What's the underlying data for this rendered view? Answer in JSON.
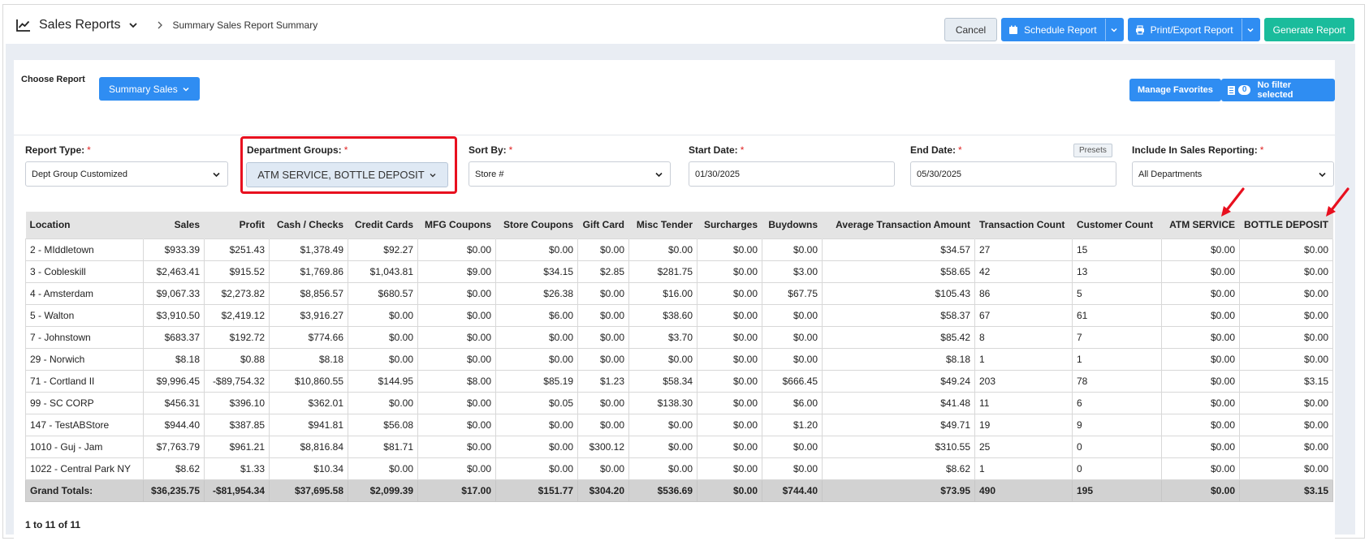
{
  "header": {
    "title": "Sales Reports",
    "breadcrumb": "Summary Sales Report Summary",
    "buttons": {
      "cancel": "Cancel",
      "schedule": "Schedule Report",
      "print_export": "Print/Export Report",
      "generate": "Generate Report"
    }
  },
  "toolbar": {
    "choose_label": "Choose Report",
    "choose_value": "Summary Sales",
    "manage_favorites": "Manage Favorites",
    "filter_count": "0",
    "filter_text": "No filter selected"
  },
  "form": {
    "report_type": {
      "label": "Report Type:",
      "value": "Dept Group Customized"
    },
    "department_groups": {
      "label": "Department Groups:",
      "value": "ATM SERVICE, BOTTLE DEPOSIT"
    },
    "sort_by": {
      "label": "Sort By:",
      "value": "Store #"
    },
    "start_date": {
      "label": "Start Date:",
      "value": "01/30/2025"
    },
    "end_date": {
      "label": "End Date:",
      "value": "05/30/2025"
    },
    "presets": "Presets",
    "include": {
      "label": "Include In Sales Reporting:",
      "value": "All Departments"
    },
    "required_mark": "*"
  },
  "table": {
    "columns": [
      "Location",
      "Sales",
      "Profit",
      "Cash / Checks",
      "Credit Cards",
      "MFG Coupons",
      "Store Coupons",
      "Gift Card",
      "Misc Tender",
      "Surcharges",
      "Buydowns",
      "Average Transaction Amount",
      "Transaction Count",
      "Customer Count",
      "ATM SERVICE",
      "BOTTLE DEPOSIT"
    ],
    "rows": [
      [
        "2 - MIddletown",
        "$933.39",
        "$251.43",
        "$1,378.49",
        "$92.27",
        "$0.00",
        "$0.00",
        "$0.00",
        "$0.00",
        "$0.00",
        "$0.00",
        "$34.57",
        "27",
        "15",
        "$0.00",
        "$0.00"
      ],
      [
        "3 - Cobleskill",
        "$2,463.41",
        "$915.52",
        "$1,769.86",
        "$1,043.81",
        "$9.00",
        "$34.15",
        "$2.85",
        "$281.75",
        "$0.00",
        "$3.00",
        "$58.65",
        "42",
        "13",
        "$0.00",
        "$0.00"
      ],
      [
        "4 - Amsterdam",
        "$9,067.33",
        "$2,273.82",
        "$8,856.57",
        "$680.57",
        "$0.00",
        "$26.38",
        "$0.00",
        "$16.00",
        "$0.00",
        "$67.75",
        "$105.43",
        "86",
        "5",
        "$0.00",
        "$0.00"
      ],
      [
        "5 - Walton",
        "$3,910.50",
        "$2,419.12",
        "$3,916.27",
        "$0.00",
        "$0.00",
        "$6.00",
        "$0.00",
        "$38.60",
        "$0.00",
        "$0.00",
        "$58.37",
        "67",
        "61",
        "$0.00",
        "$0.00"
      ],
      [
        "7 - Johnstown",
        "$683.37",
        "$192.72",
        "$774.66",
        "$0.00",
        "$0.00",
        "$0.00",
        "$0.00",
        "$3.70",
        "$0.00",
        "$0.00",
        "$85.42",
        "8",
        "7",
        "$0.00",
        "$0.00"
      ],
      [
        "29 - Norwich",
        "$8.18",
        "$0.88",
        "$8.18",
        "$0.00",
        "$0.00",
        "$0.00",
        "$0.00",
        "$0.00",
        "$0.00",
        "$0.00",
        "$8.18",
        "1",
        "1",
        "$0.00",
        "$0.00"
      ],
      [
        "71 - Cortland II",
        "$9,996.45",
        "-$89,754.32",
        "$10,860.55",
        "$144.95",
        "$8.00",
        "$85.19",
        "$1.23",
        "$58.34",
        "$0.00",
        "$666.45",
        "$49.24",
        "203",
        "78",
        "$0.00",
        "$3.15"
      ],
      [
        "99 - SC CORP",
        "$456.31",
        "$396.10",
        "$362.01",
        "$0.00",
        "$0.00",
        "$0.05",
        "$0.00",
        "$138.30",
        "$0.00",
        "$6.00",
        "$41.48",
        "11",
        "6",
        "$0.00",
        "$0.00"
      ],
      [
        "147 - TestABStore",
        "$944.40",
        "$387.85",
        "$941.81",
        "$56.08",
        "$0.00",
        "$0.00",
        "$0.00",
        "$0.00",
        "$0.00",
        "$1.20",
        "$49.71",
        "19",
        "9",
        "$0.00",
        "$0.00"
      ],
      [
        "1010 - Guj - Jam",
        "$7,763.79",
        "$961.21",
        "$8,816.84",
        "$81.71",
        "$0.00",
        "$0.00",
        "$300.12",
        "$0.00",
        "$0.00",
        "$0.00",
        "$310.55",
        "25",
        "0",
        "$0.00",
        "$0.00"
      ],
      [
        "1022 - Central Park NY",
        "$8.62",
        "$1.33",
        "$10.34",
        "$0.00",
        "$0.00",
        "$0.00",
        "$0.00",
        "$0.00",
        "$0.00",
        "$0.00",
        "$8.62",
        "1",
        "0",
        "$0.00",
        "$0.00"
      ]
    ],
    "totals": [
      "Grand Totals:",
      "$36,235.75",
      "-$81,954.34",
      "$37,695.58",
      "$2,099.39",
      "$17.00",
      "$151.77",
      "$304.20",
      "$536.69",
      "$0.00",
      "$744.40",
      "$73.95",
      "490",
      "195",
      "$0.00",
      "$3.15"
    ]
  },
  "pagination": "1 to 11 of 11",
  "colors": {
    "primary": "#2f8df2",
    "success": "#1abc9c",
    "highlight": "#e8101f",
    "arrow": "#e8101f"
  }
}
